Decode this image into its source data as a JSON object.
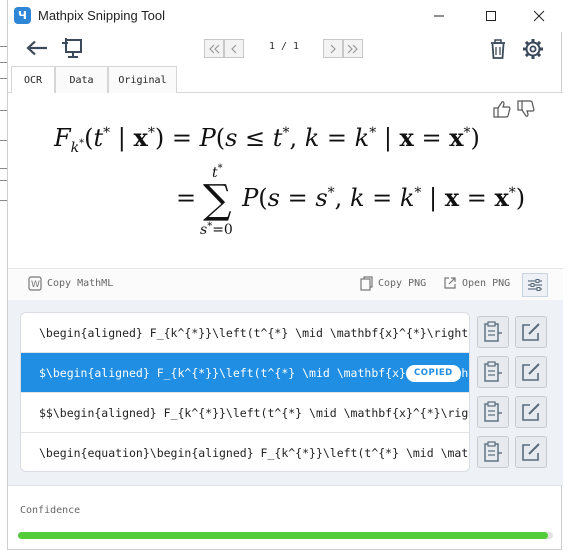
{
  "window": {
    "title": "Mathpix Snipping Tool",
    "logo_glyph": "Ч"
  },
  "toolbar": {
    "page_indicator": "1 / 1"
  },
  "tabs": [
    {
      "label": "OCR",
      "active": true
    },
    {
      "label": "Data",
      "active": false
    },
    {
      "label": "Original",
      "active": false
    }
  ],
  "actions": {
    "copy_mathml": "Copy MathML",
    "copy_png": "Copy PNG",
    "open_png": "Open PNG"
  },
  "results": [
    {
      "text": "\\begin{aligned} F_{k^{*}}\\left(t^{*} \\mid \\mathbf{x}^{*}\\right) &= P\\left(s \\leq t^{*}, k=k^{*} \\mid \\mathbf{x}=\\mathbf{x}^{*}\\right)",
      "selected": false
    },
    {
      "text": "$\\begin{aligned} F_{k^{*}}\\left(t^{*} \\mid \\mathbf{x}^{*}\\right) &= P\\left(s \\leq t^{*}",
      "selected": true,
      "badge": "COPIED"
    },
    {
      "text": "$$\\begin{aligned} F_{k^{*}}\\left(t^{*} \\mid \\mathbf{x}^{*}\\right) &= P\\left(s",
      "selected": false
    },
    {
      "text": "\\begin{equation}\\begin{aligned} F_{k^{*}}\\left(t^{*} \\mid \\mathbf{x}^{*}\\right)",
      "selected": false
    }
  ],
  "confidence": {
    "label": "Confidence",
    "value": 0.99
  },
  "colors": {
    "accent": "#1f8ee3",
    "confidence": "#53cc3a"
  }
}
